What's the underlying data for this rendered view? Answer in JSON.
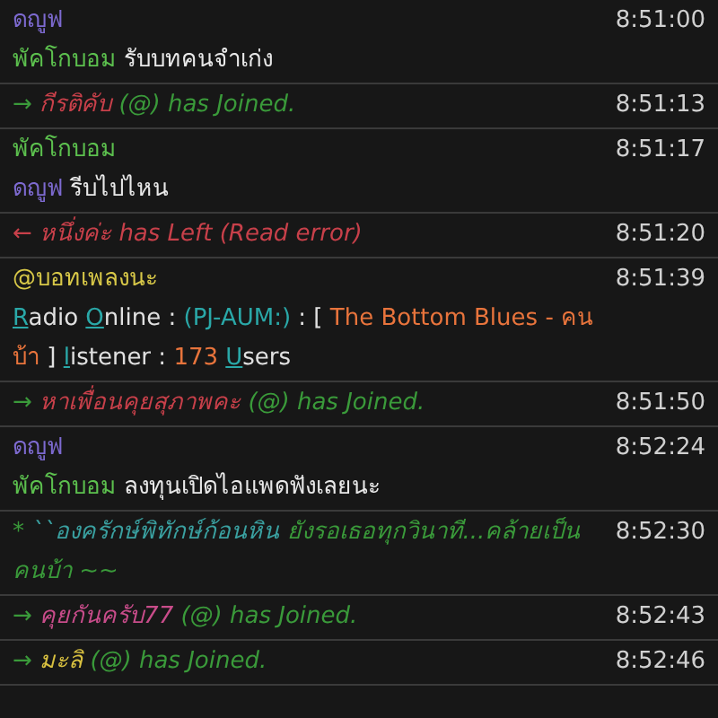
{
  "messages": [
    {
      "kind": "message",
      "sender": {
        "text": "ดญูฟ",
        "color": "#7d6ad0"
      },
      "time": "8:51:00",
      "mention": {
        "text": "พัคโกบอม",
        "color": "#5cc04e"
      },
      "text": "รับบทคนจำเก่ง"
    },
    {
      "kind": "join",
      "arrow": "→",
      "user": {
        "text": "กีรติคับ",
        "color": "#c8404a"
      },
      "suffix": "(@) has Joined.",
      "time": "8:51:13"
    },
    {
      "kind": "message",
      "sender": {
        "text": "พัคโกบอม",
        "color": "#5cc04e"
      },
      "time": "8:51:17",
      "mention": {
        "text": "ดญูฟ",
        "color": "#7d6ad0"
      },
      "text": "รีบไปไหน"
    },
    {
      "kind": "leave",
      "arrow": "←",
      "user": "หนึ่งค่ะ",
      "suffix": "has Left (Read error)",
      "time": "8:51:20"
    },
    {
      "kind": "radio",
      "sender": {
        "text": "@บอทเพลงนะ",
        "color": "#d8c848"
      },
      "time": "8:51:39",
      "segments": [
        {
          "text": "R",
          "color": "#2aa8a8",
          "underline": true
        },
        {
          "text": "adio ",
          "color": "#e0e0e0",
          "underline": false
        },
        {
          "text": "O",
          "color": "#2aa8a8",
          "underline": true
        },
        {
          "text": "nline : ",
          "color": "#e0e0e0",
          "underline": false
        },
        {
          "text": "(PJ-AUM:)",
          "color": "#2aa8a8",
          "underline": false
        },
        {
          "text": " : [ ",
          "color": "#e0e0e0",
          "underline": false
        },
        {
          "text": "The Bottom Blues - คนบ้า",
          "color": "#e8743c",
          "underline": false
        },
        {
          "text": " ] ",
          "color": "#e0e0e0",
          "underline": false
        },
        {
          "text": "l",
          "color": "#2aa8a8",
          "underline": true
        },
        {
          "text": "istener : ",
          "color": "#e0e0e0",
          "underline": false
        },
        {
          "text": "173 ",
          "color": "#e8743c",
          "underline": false
        },
        {
          "text": "U",
          "color": "#2aa8a8",
          "underline": true
        },
        {
          "text": "sers",
          "color": "#e0e0e0",
          "underline": false
        }
      ]
    },
    {
      "kind": "join",
      "arrow": "→",
      "user": {
        "text": "หาเพื่อนคุยสุภาพคะ",
        "color": "#c8404a"
      },
      "suffix": "(@) has Joined.",
      "time": "8:51:50"
    },
    {
      "kind": "message",
      "sender": {
        "text": "ดญูฟ",
        "color": "#7d6ad0"
      },
      "time": "8:52:24",
      "mention": {
        "text": "พัคโกบอม",
        "color": "#5cc04e"
      },
      "text": "ลงทุนเปิดไอแพดฟังเลยนะ"
    },
    {
      "kind": "action",
      "mark": "*",
      "user": "``องครักษ์พิทักษ์ก้อนหิน",
      "text": "ยังรอเธอทุกวินาที...คล้ายเป็นคนบ้า ~~",
      "time": "8:52:30"
    },
    {
      "kind": "join",
      "arrow": "→",
      "user": {
        "text": "คุยกันครับ77",
        "color": "#c84c8a"
      },
      "suffix": "(@) has Joined.",
      "time": "8:52:43"
    },
    {
      "kind": "join",
      "arrow": "→",
      "user": {
        "text": "มะลิ",
        "color": "#d8c040"
      },
      "suffix": "(@) has Joined.",
      "time": "8:52:46"
    }
  ]
}
